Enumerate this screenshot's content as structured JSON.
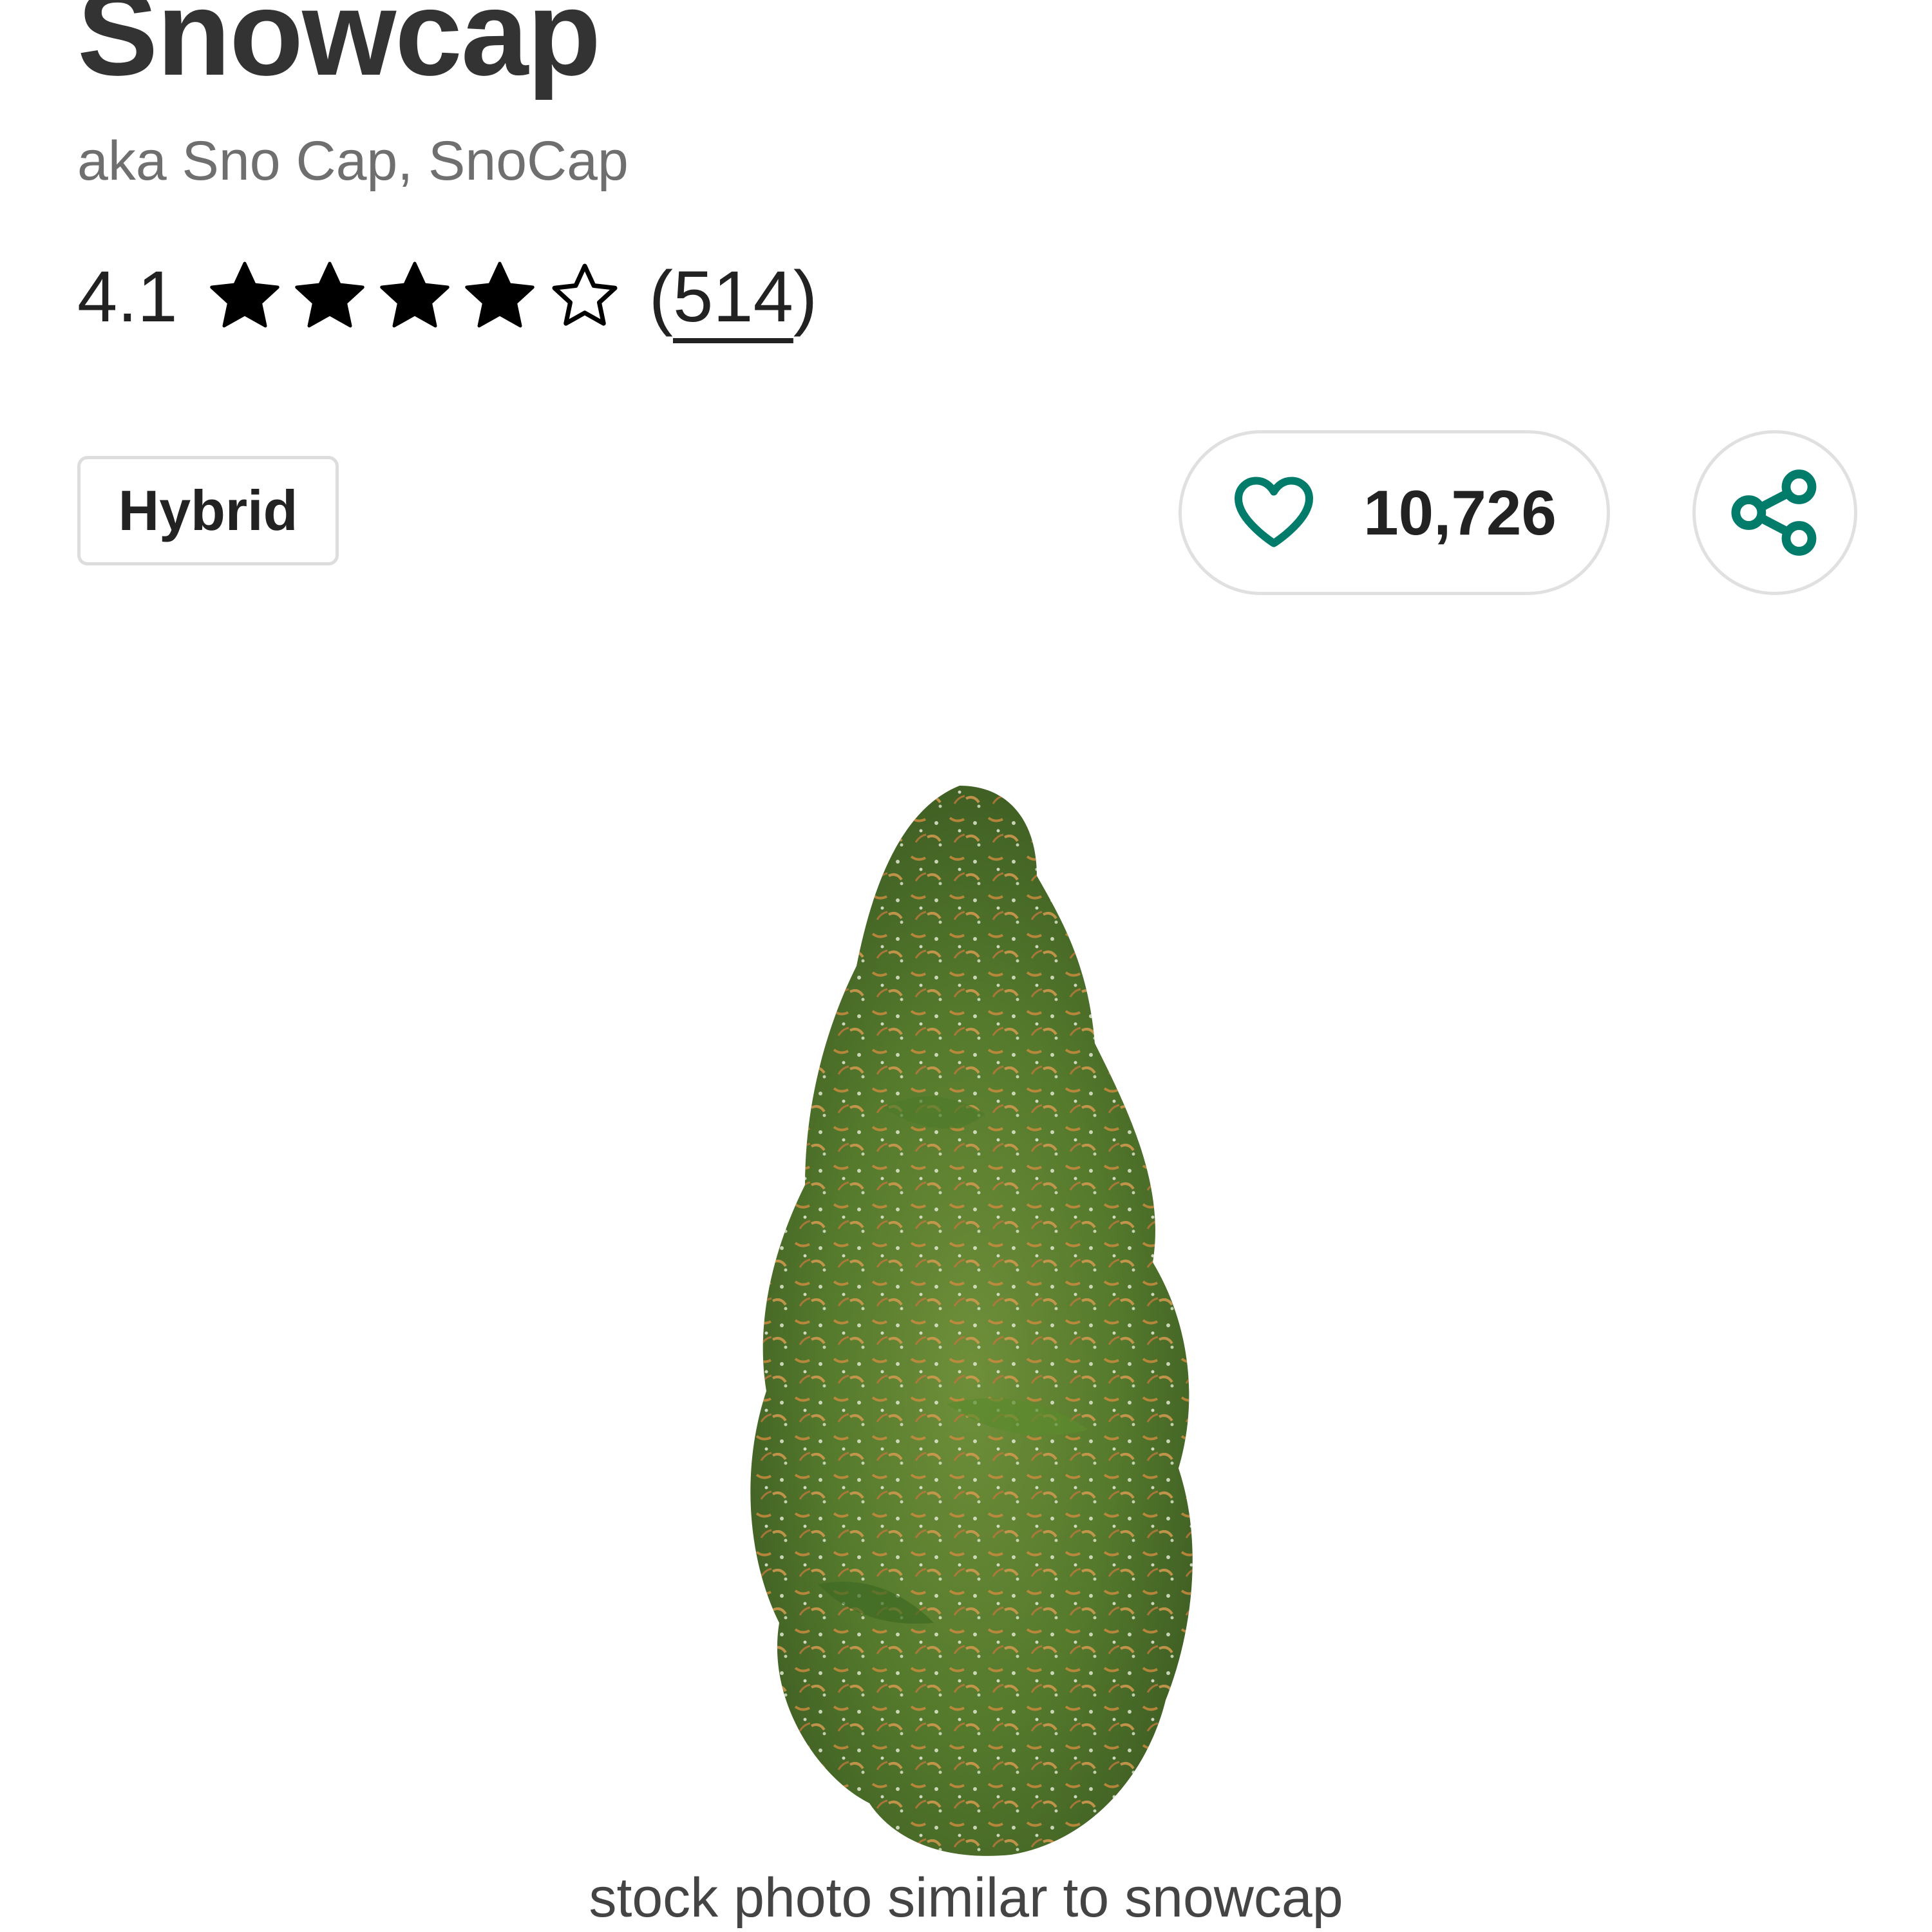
{
  "strain": {
    "name": "Snowcap",
    "aka": "aka Sno Cap, SnoCap",
    "type": "Hybrid"
  },
  "rating": {
    "value": "4.1",
    "stars_filled": 4,
    "stars_total": 5,
    "review_count": "514",
    "open_paren": "(",
    "close_paren": ")"
  },
  "favorites": {
    "count": "10,726",
    "icon": "heart-outline-icon"
  },
  "share": {
    "icon": "share-icon"
  },
  "photo": {
    "caption": "stock photo similar to snowcap"
  },
  "colors": {
    "accent": "#017c6b",
    "text": "#222222",
    "muted": "#6f6f6f",
    "border": "#dddddd"
  }
}
